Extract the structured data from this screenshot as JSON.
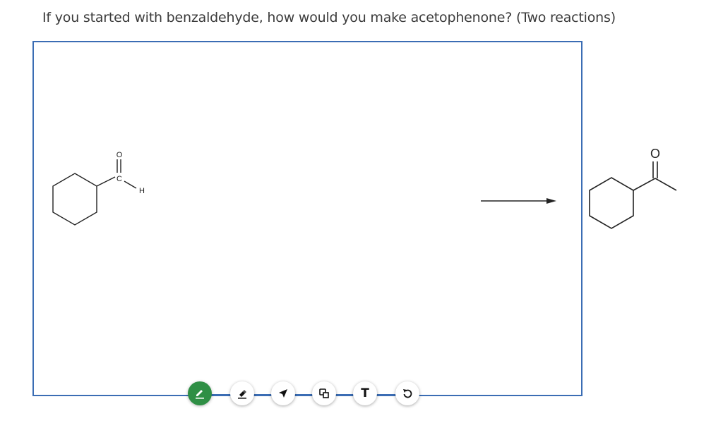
{
  "question": {
    "text": "If you started with benzaldehyde, how would you make acetophenone? (Two reactions)"
  },
  "canvas": {
    "border_color": "#3b6db4",
    "reactant": {
      "labels": {
        "oxygen": "O",
        "carbon": "C",
        "hydrogen": "H"
      }
    },
    "product": {
      "labels": {
        "oxygen": "O"
      }
    }
  },
  "toolbar": {
    "active_color": "#2f8f45",
    "tools": [
      {
        "name": "pencil",
        "icon": "pencil-icon",
        "active": true
      },
      {
        "name": "eraser",
        "icon": "eraser-icon",
        "active": false
      },
      {
        "name": "select",
        "icon": "arrow-pointer-icon",
        "active": false
      },
      {
        "name": "shapes",
        "icon": "shapes-icon",
        "active": false
      },
      {
        "name": "text",
        "icon": "text-icon",
        "label": "T",
        "active": false
      },
      {
        "name": "undo",
        "icon": "undo-icon",
        "active": false
      }
    ]
  }
}
